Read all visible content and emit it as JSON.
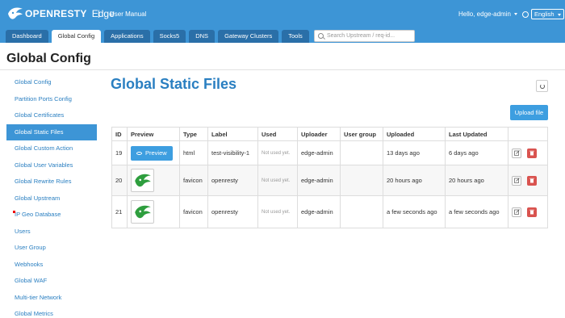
{
  "header": {
    "brand_name": "OPENRESTY",
    "brand_suffix": "Edge",
    "separator": "|",
    "manual_link": "User Manual",
    "user_greeting": "Hello, edge-admin",
    "language": "English"
  },
  "nav": {
    "tabs": [
      {
        "label": "Dashboard"
      },
      {
        "label": "Global Config"
      },
      {
        "label": "Applications"
      },
      {
        "label": "Socks5"
      },
      {
        "label": "DNS"
      },
      {
        "label": "Gateway Clusters"
      },
      {
        "label": "Tools"
      }
    ],
    "active_tab": "Global Config",
    "search_placeholder": "Search Upstream / req-id..."
  },
  "page_title": "Global Config",
  "sidebar": {
    "items": [
      {
        "label": "Global Config"
      },
      {
        "label": "Partition Ports Config"
      },
      {
        "label": "Global Certificates"
      },
      {
        "label": "Global Static Files"
      },
      {
        "label": "Global Custom Action"
      },
      {
        "label": "Global User Variables"
      },
      {
        "label": "Global Rewrite Rules"
      },
      {
        "label": "Global Upstream"
      },
      {
        "label": "IP Geo Database"
      },
      {
        "label": "Users"
      },
      {
        "label": "User Group"
      },
      {
        "label": "Webhooks"
      },
      {
        "label": "Global WAF"
      },
      {
        "label": "Multi-tier Network"
      },
      {
        "label": "Global Metrics"
      }
    ],
    "active_item": "Global Static Files"
  },
  "main": {
    "title": "Global Static Files",
    "upload_label": "Upload file",
    "table": {
      "columns": [
        "ID",
        "Preview",
        "Type",
        "Label",
        "Used",
        "Uploader",
        "User group",
        "Uploaded",
        "Last Updated",
        ""
      ],
      "rows": [
        {
          "id": "19",
          "preview": "Preview",
          "type": "html",
          "label": "test-visibility-1",
          "used": "Not used yet.",
          "uploader": "edge-admin",
          "user_group": "",
          "uploaded": "13 days ago",
          "last_updated": "6 days ago"
        },
        {
          "id": "20",
          "preview": "",
          "type": "favicon",
          "label": "openresty",
          "used": "Not used yet.",
          "uploader": "edge-admin",
          "user_group": "",
          "uploaded": "20 hours ago",
          "last_updated": "20 hours ago"
        },
        {
          "id": "21",
          "preview": "",
          "type": "favicon",
          "label": "openresty",
          "used": "Not used yet.",
          "uploader": "edge-admin",
          "user_group": "",
          "uploaded": "a few seconds ago",
          "last_updated": "a few seconds ago"
        }
      ]
    }
  },
  "colors": {
    "topbar": "#3d95d6",
    "link": "#2a7fc1",
    "primary_button": "#3d9ee0",
    "danger": "#d9534f",
    "logo_green": "#2e9e3e"
  }
}
